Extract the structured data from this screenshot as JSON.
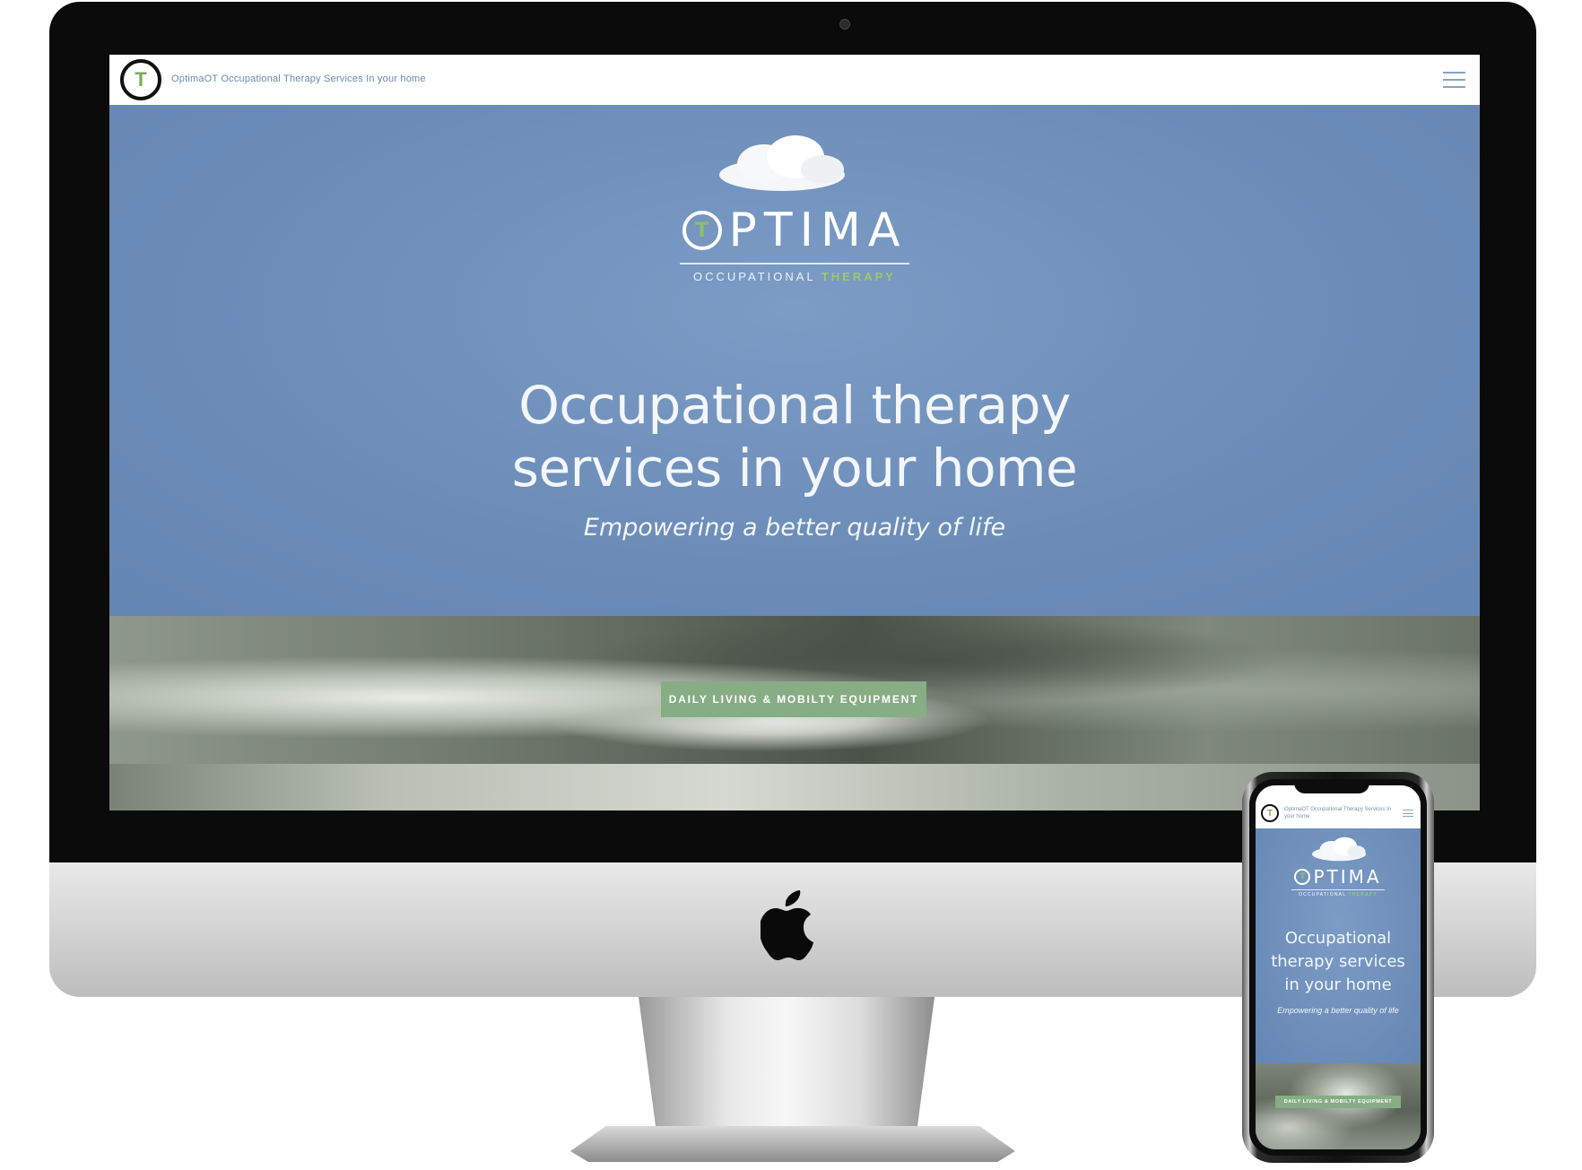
{
  "desktop": {
    "site_title": "OptimaOT Occupational Therapy Services In your home",
    "logo_letter": "T",
    "brand": {
      "name_rest": "PTIMA",
      "sub_left": "OCCUPATIONAL",
      "sub_right": "THERAPY"
    },
    "hero": {
      "headline": "Occupational therapy services in your home",
      "tagline": "Empowering a better quality of life"
    },
    "cta_label": "DAILY LIVING & MOBILTY EQUIPMENT",
    "menu_icon": "hamburger-menu-icon"
  },
  "mobile": {
    "site_title": "OptimaOT Occupational Therapy Services In your home",
    "logo_letter": "T",
    "brand": {
      "name_rest": "PTIMA",
      "sub_left": "OCCUPATIONAL",
      "sub_right": "THERAPY"
    },
    "hero": {
      "headline": "Occupational therapy services in your home",
      "tagline": "Empowering a better quality of life"
    },
    "cta_label": "DAILY LIVING & MOBILTY EQUIPMENT",
    "menu_icon": "hamburger-menu-icon"
  },
  "colors": {
    "hero_blue": "#6d8fb8",
    "accent_green": "#86ad84",
    "brand_green": "#9cc96c",
    "title_text": "#6d89a8"
  }
}
